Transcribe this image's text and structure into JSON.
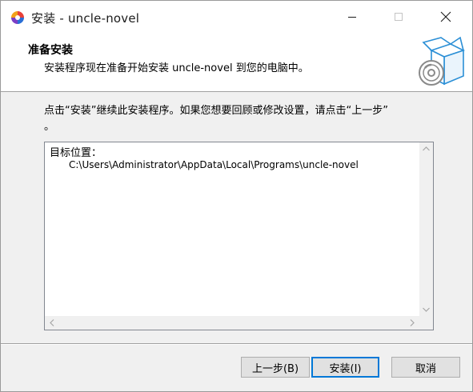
{
  "window": {
    "title": "安装 - uncle-novel"
  },
  "header": {
    "title": "准备安装",
    "subtitle": "安装程序现在准备开始安装 uncle-novel 到您的电脑中。"
  },
  "content": {
    "instruction_line1": "点击“安装”继续此安装程序。如果您想要回顾或修改设置，请点击“上一步”",
    "instruction_line2": "。",
    "listbox": {
      "label": "目标位置：",
      "path": "C:\\Users\\Administrator\\AppData\\Local\\Programs\\uncle-novel"
    }
  },
  "buttons": {
    "back": "上一步(B)",
    "install": "安装(I)",
    "cancel": "取消"
  },
  "colors": {
    "accent": "#0078d7",
    "header_bg": "#ffffff",
    "body_bg": "#f0f0f0"
  }
}
